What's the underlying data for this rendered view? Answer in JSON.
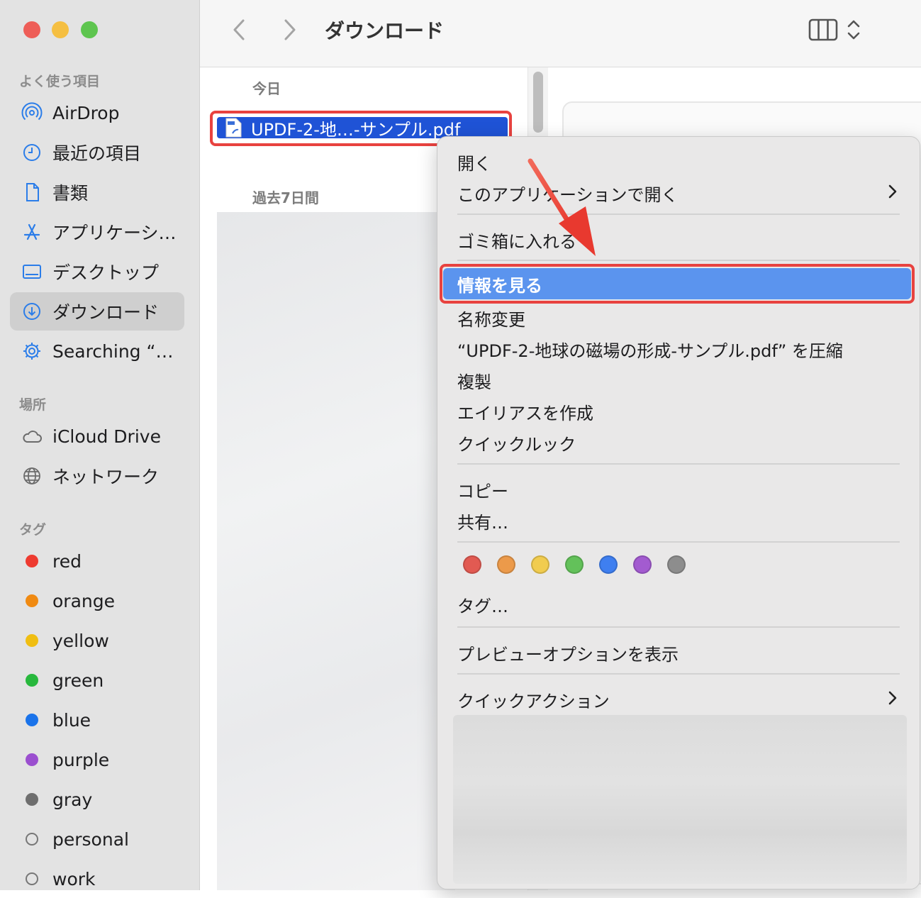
{
  "window": {
    "title": "ダウンロード"
  },
  "sidebar": {
    "favorites_header": "よく使う項目",
    "favorites": [
      {
        "label": "AirDrop",
        "icon": "airdrop-icon"
      },
      {
        "label": "最近の項目",
        "icon": "clock-icon"
      },
      {
        "label": "書類",
        "icon": "document-icon"
      },
      {
        "label": "アプリケーシ…",
        "icon": "applications-icon"
      },
      {
        "label": "デスクトップ",
        "icon": "desktop-icon"
      },
      {
        "label": "ダウンロード",
        "icon": "download-icon",
        "selected": true
      },
      {
        "label": "Searching “…",
        "icon": "gear-icon"
      }
    ],
    "locations_header": "場所",
    "locations": [
      {
        "label": "iCloud Drive",
        "icon": "cloud-icon"
      },
      {
        "label": "ネットワーク",
        "icon": "globe-icon"
      }
    ],
    "tags_header": "タグ",
    "tags": [
      {
        "label": "red",
        "color": "#ee3b30"
      },
      {
        "label": "orange",
        "color": "#f08a12"
      },
      {
        "label": "yellow",
        "color": "#f0be12"
      },
      {
        "label": "green",
        "color": "#28b83d"
      },
      {
        "label": "blue",
        "color": "#1a73ea"
      },
      {
        "label": "purple",
        "color": "#9b4fcf"
      },
      {
        "label": "gray",
        "color": "#6e6e6e"
      },
      {
        "label": "personal",
        "color": ""
      },
      {
        "label": "work",
        "color": ""
      }
    ]
  },
  "file_list": {
    "group_today": "今日",
    "group_past7": "過去7日間",
    "selected_file": "UPDF-2-地…-サンプル.pdf",
    "file_icon": "pdf-file-icon"
  },
  "context_menu": {
    "open": "開く",
    "open_with": "このアプリケーションで開く",
    "trash": "ゴミ箱に入れる",
    "get_info": "情報を見る",
    "rename": "名称変更",
    "compress": "“UPDF-2-地球の磁場の形成-サンプル.pdf” を圧縮",
    "duplicate": "複製",
    "make_alias": "エイリアスを作成",
    "quick_look": "クイックルック",
    "copy": "コピー",
    "share": "共有…",
    "tag_colors": [
      "#e25a52",
      "#ec9a4a",
      "#f1cc4f",
      "#63c15a",
      "#3f7ff0",
      "#a35bd0",
      "#8d8d8d"
    ],
    "tags": "タグ…",
    "show_preview_options": "プレビューオプションを表示",
    "quick_actions": "クイックアクション"
  },
  "annotation": {
    "highlight_color": "#e8423f"
  }
}
